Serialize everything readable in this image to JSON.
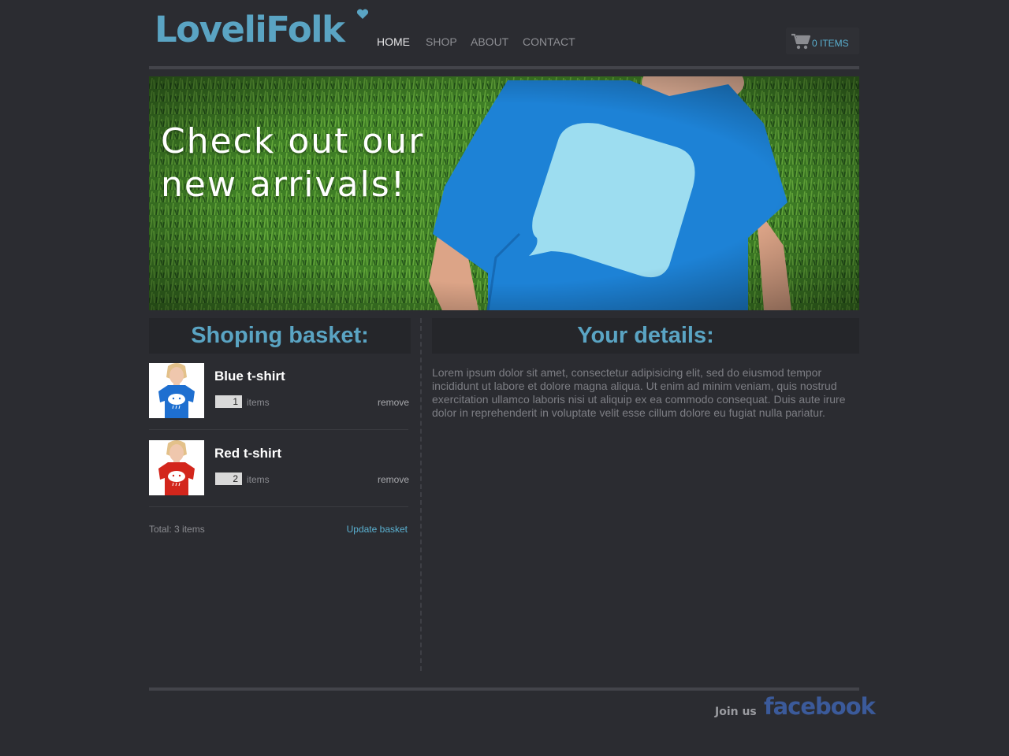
{
  "brand": {
    "name": "LoveliFolk",
    "accent_color": "#5aa4c3"
  },
  "nav": {
    "items": [
      {
        "label": "HOME",
        "active": true
      },
      {
        "label": "SHOP",
        "active": false
      },
      {
        "label": "ABOUT",
        "active": false
      },
      {
        "label": "CONTACT",
        "active": false
      }
    ]
  },
  "cart": {
    "icon": "shopping-cart-icon",
    "label": "0 ITEMS"
  },
  "banner": {
    "headline_line1": "Check out our",
    "headline_line2": "new arrivals!"
  },
  "basket": {
    "title": "Shoping basket:",
    "items": [
      {
        "name": "Blue t-shirt",
        "quantity": "1",
        "unit_label": "items",
        "remove_label": "remove",
        "shirt_color": "#1e6fd0"
      },
      {
        "name": "Red t-shirt",
        "quantity": "2",
        "unit_label": "items",
        "remove_label": "remove",
        "shirt_color": "#d3261c"
      }
    ],
    "total_label": "Total: 3 items",
    "update_label": "Update basket"
  },
  "details": {
    "title": "Your details:",
    "body": "Lorem ipsum dolor sit amet, consectetur adipisicing elit, sed do eiusmod tempor incididunt ut labore et dolore magna aliqua. Ut enim ad minim veniam, quis nostrud exercitation ullamco laboris nisi ut aliquip ex ea commodo consequat. Duis aute irure dolor in reprehenderit in voluptate velit esse cillum dolore eu fugiat nulla pariatur."
  },
  "footer": {
    "join_label": "Join us",
    "social_label": "facebook"
  }
}
